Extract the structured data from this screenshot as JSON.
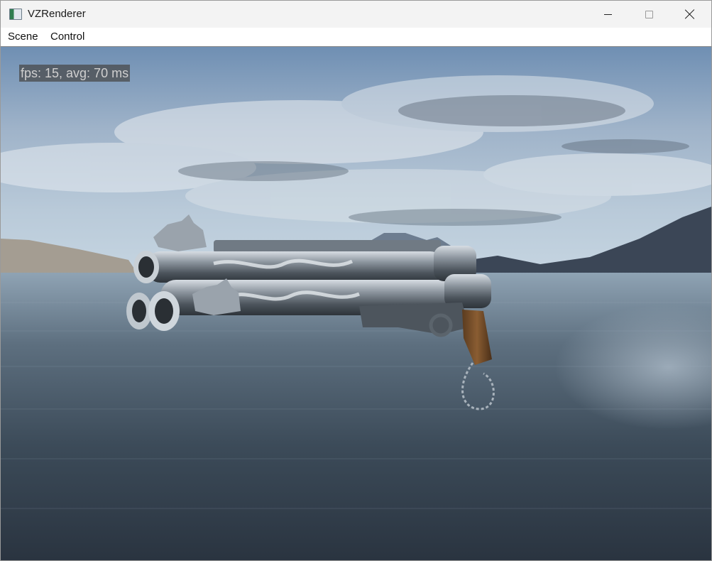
{
  "window": {
    "title": "VZRenderer",
    "icon": "app-icon",
    "controls": [
      "minimize-icon",
      "maximize-icon",
      "close-icon"
    ]
  },
  "menu": {
    "items": [
      {
        "label": "Scene"
      },
      {
        "label": "Control"
      }
    ]
  },
  "viewport": {
    "fps_text": "fps: 15, avg: 70 ms"
  }
}
